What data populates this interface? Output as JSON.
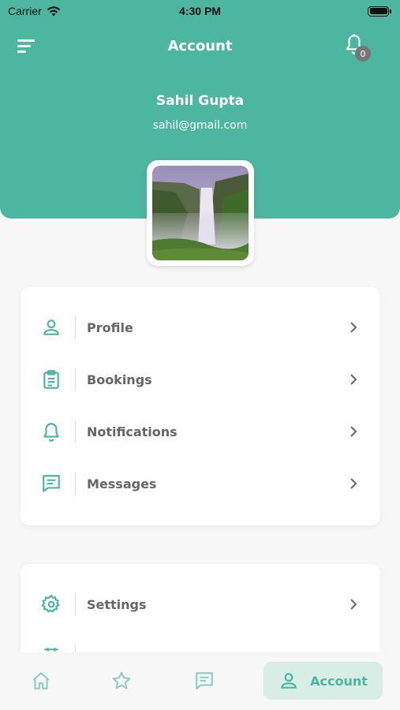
{
  "status_bar": {
    "carrier": "Carrier",
    "time": "4:30 PM"
  },
  "header": {
    "title": "Account",
    "notification_count": "0",
    "accent_color": "#4db6a0"
  },
  "user": {
    "name": "Sahil Gupta",
    "email": "sahil@gmail.com"
  },
  "menu_primary": [
    {
      "label": "Profile",
      "icon": "person-icon"
    },
    {
      "label": "Bookings",
      "icon": "clipboard-icon"
    },
    {
      "label": "Notifications",
      "icon": "bell-icon"
    },
    {
      "label": "Messages",
      "icon": "chat-icon"
    }
  ],
  "menu_secondary": [
    {
      "label": "Settings",
      "icon": "gear-icon"
    },
    {
      "label": "",
      "icon": "partial-icon"
    }
  ],
  "tab_bar": {
    "items": [
      {
        "label": "",
        "icon": "home-icon"
      },
      {
        "label": "",
        "icon": "star-icon"
      },
      {
        "label": "",
        "icon": "chat-icon"
      },
      {
        "label": "Account",
        "icon": "person-icon",
        "active": true
      }
    ]
  }
}
